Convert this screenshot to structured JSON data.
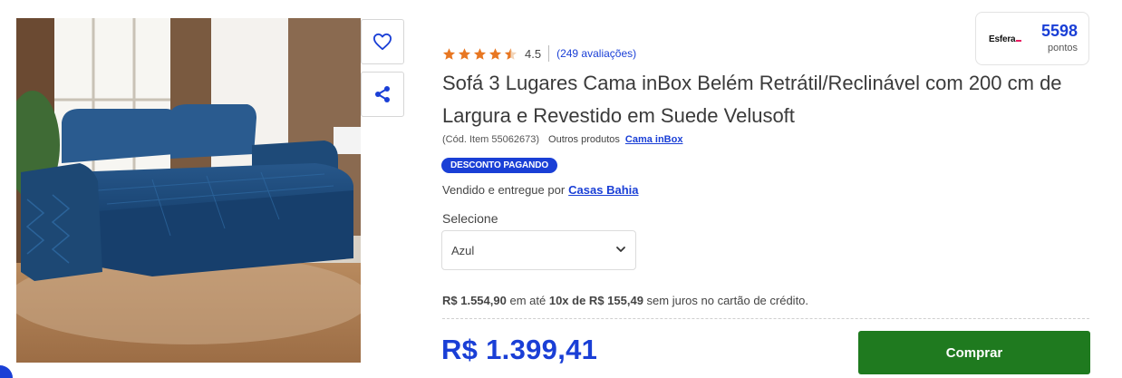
{
  "product": {
    "title": "Sofá 3 Lugares Cama inBox Belém Retrátil/Reclinável com 200 cm de Largura e Revestido em Suede Velusoft",
    "image_alt": "Sofá retrátil azul",
    "code": "(Cód. Item 55062673)",
    "other_products_label": "Outros produtos",
    "brand": "Cama inBox",
    "badge": "DESCONTO PAGANDO",
    "seller_prefix": "Vendido e entregue por",
    "seller": "Casas Bahia"
  },
  "actions": {
    "favorite_icon": "heart-icon",
    "share_icon": "share-icon"
  },
  "rating": {
    "stars": 4.5,
    "value": "4.5",
    "count": "(249 avaliações)",
    "star_color": "#e87722"
  },
  "esfera": {
    "logo": "Esfera",
    "points": "5598",
    "points_label": "pontos"
  },
  "variant": {
    "label": "Selecione",
    "selected": "Azul"
  },
  "pricing": {
    "installment_full_price": "R$ 1.554,90",
    "installment_mid1": "em até",
    "installment_plan": "10x de R$ 155,49",
    "installment_suffix": "sem juros no cartão de crédito.",
    "price": "R$ 1.399,41"
  },
  "buy": {
    "label": "Comprar"
  },
  "colors": {
    "accent": "#1a3fd6",
    "buy_button": "#1f7a1f",
    "star": "#e87722"
  }
}
